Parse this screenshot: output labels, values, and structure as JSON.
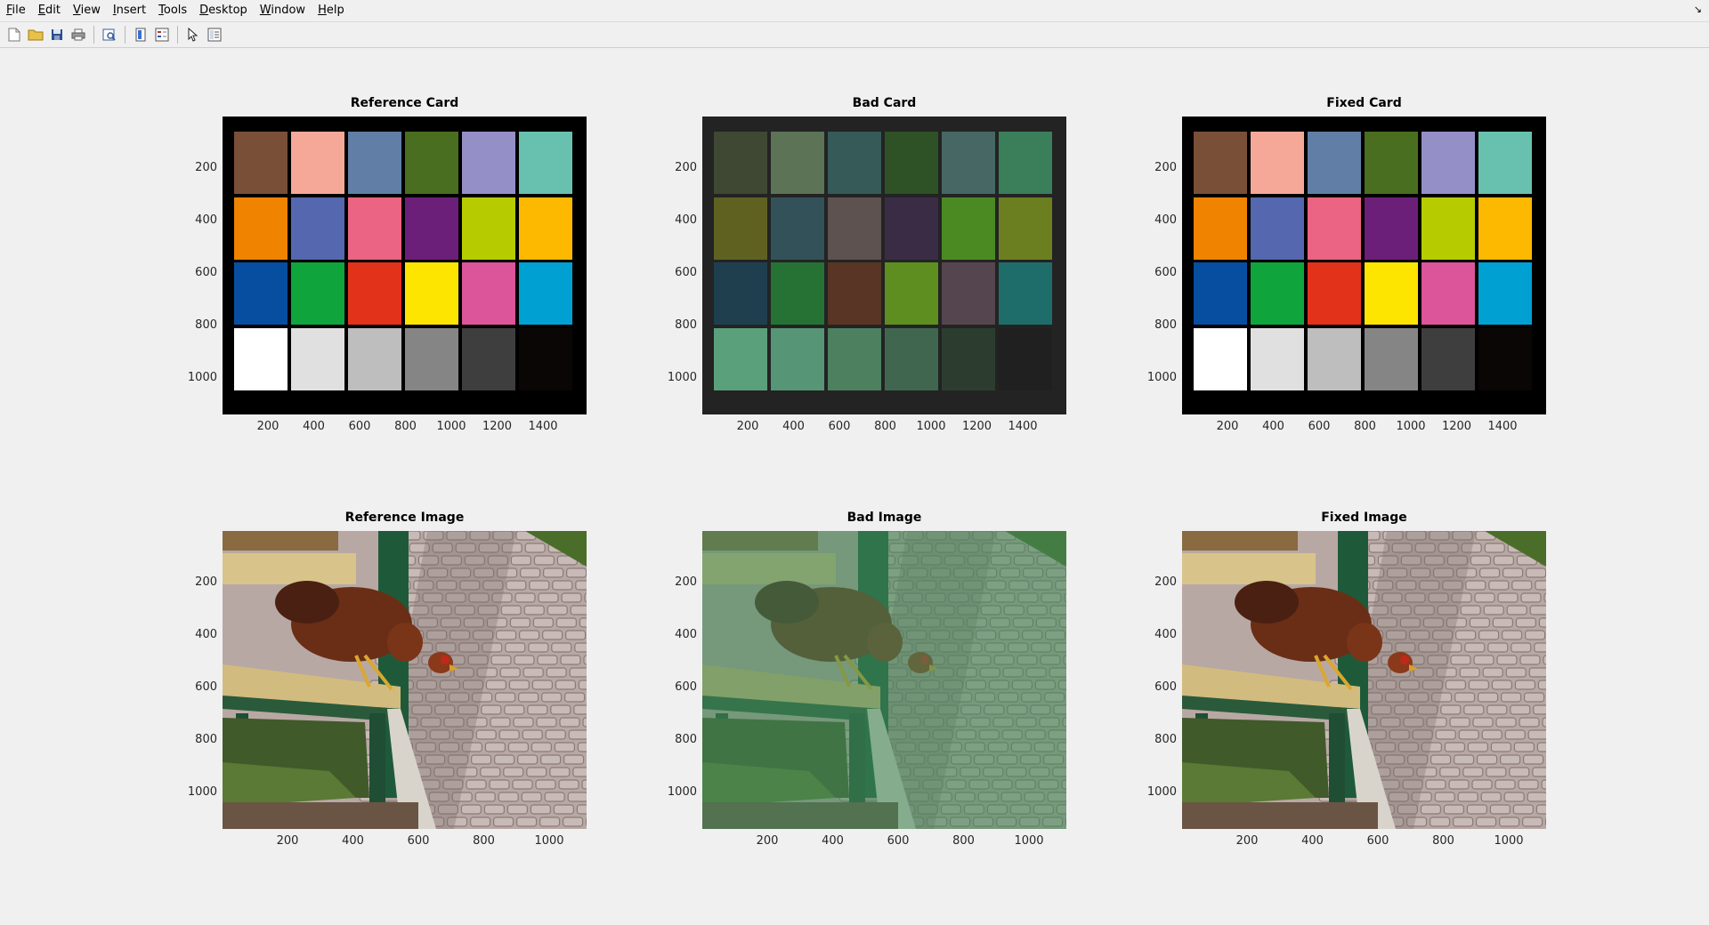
{
  "menu": [
    "File",
    "Edit",
    "View",
    "Insert",
    "Tools",
    "Desktop",
    "Window",
    "Help"
  ],
  "toolbar_icons": [
    "new-figure-icon",
    "open-file-icon",
    "save-icon",
    "print-icon",
    "print-preview-icon",
    "colorbar-icon",
    "legend-icon",
    "pointer-icon",
    "property-inspector-icon"
  ],
  "panels": [
    {
      "title": "Reference Card",
      "kind": "card",
      "xticks": [
        "200",
        "400",
        "600",
        "800",
        "1000",
        "1200",
        "1400"
      ],
      "yticks": [
        "200",
        "400",
        "600",
        "800",
        "1000"
      ]
    },
    {
      "title": "Bad Card",
      "kind": "card",
      "xticks": [
        "200",
        "400",
        "600",
        "800",
        "1000",
        "1200",
        "1400"
      ],
      "yticks": [
        "200",
        "400",
        "600",
        "800",
        "1000"
      ]
    },
    {
      "title": "Fixed Card",
      "kind": "card",
      "xticks": [
        "200",
        "400",
        "600",
        "800",
        "1000",
        "1200",
        "1400"
      ],
      "yticks": [
        "200",
        "400",
        "600",
        "800",
        "1000"
      ]
    },
    {
      "title": "Reference Image",
      "kind": "image",
      "xticks": [
        "200",
        "400",
        "600",
        "800",
        "1000"
      ],
      "yticks": [
        "200",
        "400",
        "600",
        "800",
        "1000"
      ]
    },
    {
      "title": "Bad Image",
      "kind": "image",
      "xticks": [
        "200",
        "400",
        "600",
        "800",
        "1000"
      ],
      "yticks": [
        "200",
        "400",
        "600",
        "800",
        "1000"
      ]
    },
    {
      "title": "Fixed Image",
      "kind": "image",
      "xticks": [
        "200",
        "400",
        "600",
        "800",
        "1000"
      ],
      "yticks": [
        "200",
        "400",
        "600",
        "800",
        "1000"
      ]
    }
  ],
  "card_colors": {
    "reference": [
      "#7a4f37",
      "#f5a898",
      "#617fa6",
      "#4a6e1f",
      "#9490c7",
      "#68c1ae",
      "#f08300",
      "#5567af",
      "#ec6483",
      "#6c1f78",
      "#b7cc00",
      "#fcb900",
      "#074ea0",
      "#10a43c",
      "#e3321a",
      "#fde500",
      "#dc549a",
      "#00a0d2",
      "#ffffff",
      "#e0e0e0",
      "#bebebe",
      "#858585",
      "#3e3e3e",
      "#0a0605"
    ],
    "bad": [
      "#3f4833",
      "#5c7455",
      "#355a58",
      "#2e5125",
      "#466764",
      "#3a7e5a",
      "#5f6121",
      "#335158",
      "#5d5250",
      "#3b2c46",
      "#4b8a23",
      "#6b7f21",
      "#1f3f4f",
      "#267235",
      "#593525",
      "#5f8e20",
      "#55454f",
      "#1e6d6a",
      "#5aa07b",
      "#569676",
      "#4d805f",
      "#416650",
      "#2c3d30",
      "#202020"
    ],
    "fixed": [
      "#7a4f37",
      "#f5a898",
      "#617fa6",
      "#4a6e1f",
      "#9490c7",
      "#68c1ae",
      "#f08300",
      "#5567af",
      "#ec6483",
      "#6c1f78",
      "#b7cc00",
      "#fcb900",
      "#074ea0",
      "#10a43c",
      "#e3321a",
      "#fde500",
      "#dc549a",
      "#00a0d2",
      "#ffffff",
      "#e0e0e0",
      "#bebebe",
      "#858585",
      "#3e3e3e",
      "#0a0605"
    ]
  },
  "card_frame_colors": {
    "reference": "#000000",
    "bad": "#232323",
    "fixed": "#000000"
  },
  "photo_tints": {
    "reference": "none",
    "bad": "#3f8a5a",
    "fixed": "none"
  }
}
